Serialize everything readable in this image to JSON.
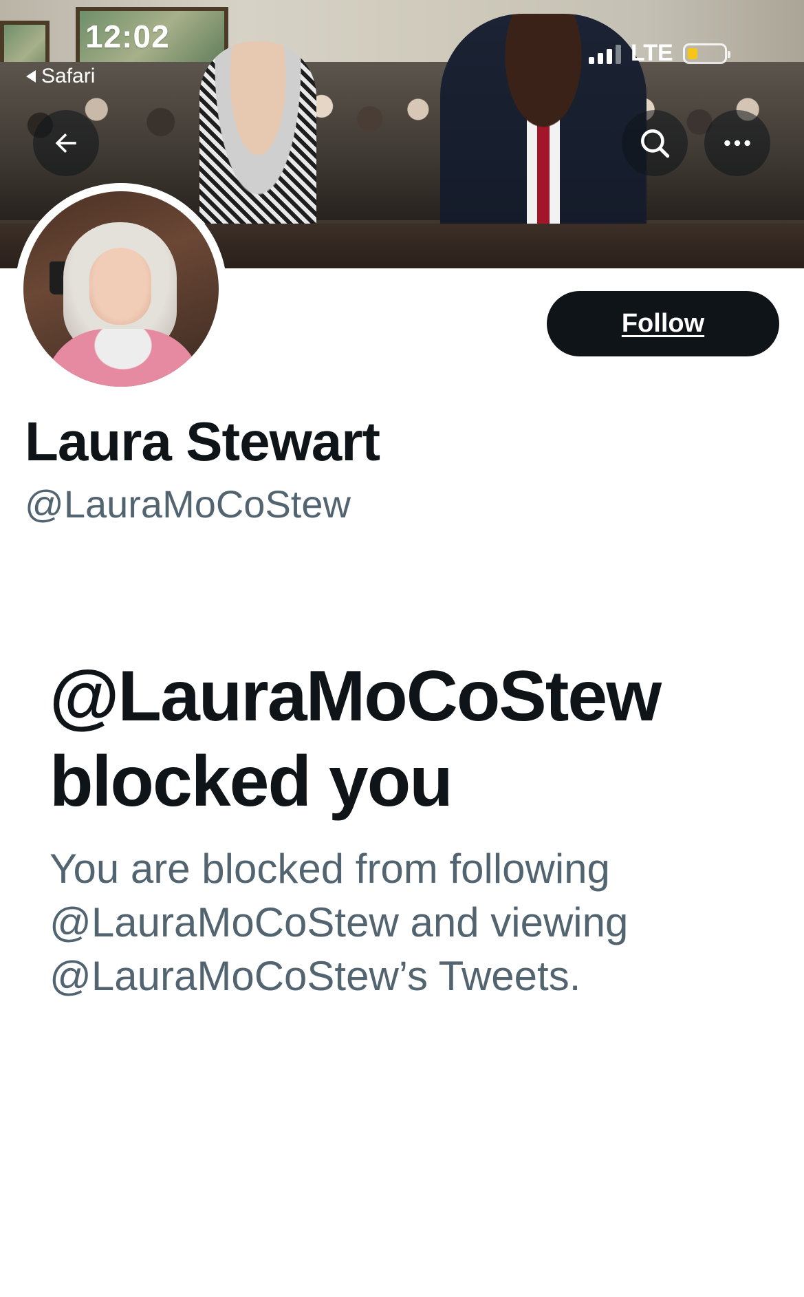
{
  "status_bar": {
    "time": "12:02",
    "back_app": "Safari",
    "network": "LTE",
    "battery_color": "#f5c518"
  },
  "header": {
    "back_icon": "arrow-left-icon",
    "search_icon": "search-icon",
    "more_icon": "more-horizontal-icon"
  },
  "profile": {
    "display_name": "Laura Stewart",
    "handle": "@LauraMoCoStew",
    "follow_label": "Follow"
  },
  "blocked": {
    "title": "@LauraMoCoStew blocked you",
    "description": "You are blocked from following @LauraMoCoStew and viewing @LauraMoCoStew’s Tweets."
  },
  "colors": {
    "primary_text": "#0f1419",
    "secondary_text": "#536471",
    "button_bg": "#0f1419",
    "background": "#ffffff"
  }
}
